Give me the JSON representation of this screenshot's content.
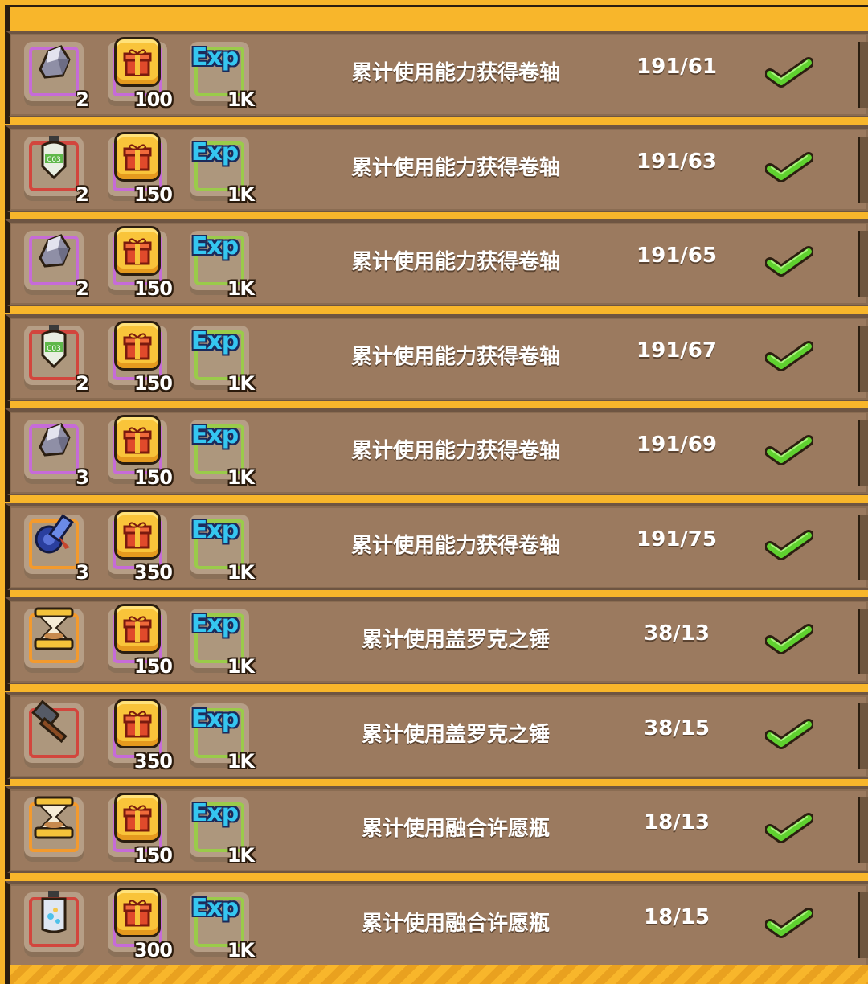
{
  "colors": {
    "panel_frame": "#f8b62b",
    "row_bg": "#9b7a5f",
    "check_green": "#5fd12f",
    "exp_cyan": "#35c6f0"
  },
  "rewards_list": [
    {
      "item_icon": "ore-crystal-icon",
      "item_frame": "purple",
      "item_count": "2",
      "coin_count": "100",
      "exp_label": "Exp",
      "exp_count": "1K",
      "task": "累计使用能力获得卷轴",
      "progress": "191/61",
      "status_icon": "checkmark-icon"
    },
    {
      "item_icon": "potion-bottle-icon",
      "item_frame": "red",
      "item_count": "2",
      "coin_count": "150",
      "exp_label": "Exp",
      "exp_count": "1K",
      "task": "累计使用能力获得卷轴",
      "progress": "191/63",
      "status_icon": "checkmark-icon"
    },
    {
      "item_icon": "ore-crystal-icon",
      "item_frame": "purple",
      "item_count": "2",
      "coin_count": "150",
      "exp_label": "Exp",
      "exp_count": "1K",
      "task": "累计使用能力获得卷轴",
      "progress": "191/65",
      "status_icon": "checkmark-icon"
    },
    {
      "item_icon": "potion-bottle-icon",
      "item_frame": "red",
      "item_count": "2",
      "coin_count": "150",
      "exp_label": "Exp",
      "exp_count": "1K",
      "task": "累计使用能力获得卷轴",
      "progress": "191/67",
      "status_icon": "checkmark-icon"
    },
    {
      "item_icon": "ore-crystal-icon",
      "item_frame": "purple",
      "item_count": "3",
      "coin_count": "150",
      "exp_label": "Exp",
      "exp_count": "1K",
      "task": "累计使用能力获得卷轴",
      "progress": "191/69",
      "status_icon": "checkmark-icon"
    },
    {
      "item_icon": "scroll-icon",
      "item_frame": "orange",
      "item_count": "3",
      "coin_count": "350",
      "exp_label": "Exp",
      "exp_count": "1K",
      "task": "累计使用能力获得卷轴",
      "progress": "191/75",
      "status_icon": "checkmark-icon"
    },
    {
      "item_icon": "hourglass-icon",
      "item_frame": "orange",
      "item_count": "",
      "coin_count": "150",
      "exp_label": "Exp",
      "exp_count": "1K",
      "task": "累计使用盖罗克之锤",
      "progress": "38/13",
      "status_icon": "checkmark-icon"
    },
    {
      "item_icon": "hammer-icon",
      "item_frame": "red",
      "item_count": "",
      "coin_count": "350",
      "exp_label": "Exp",
      "exp_count": "1K",
      "task": "累计使用盖罗克之锤",
      "progress": "38/15",
      "status_icon": "checkmark-icon"
    },
    {
      "item_icon": "hourglass-icon",
      "item_frame": "orange",
      "item_count": "",
      "coin_count": "150",
      "exp_label": "Exp",
      "exp_count": "1K",
      "task": "累计使用融合许愿瓶",
      "progress": "18/13",
      "status_icon": "checkmark-icon"
    },
    {
      "item_icon": "wish-bottle-icon",
      "item_frame": "red",
      "item_count": "",
      "coin_count": "300",
      "exp_label": "Exp",
      "exp_count": "1K",
      "task": "累计使用融合许愿瓶",
      "progress": "18/15",
      "status_icon": "checkmark-icon"
    }
  ]
}
